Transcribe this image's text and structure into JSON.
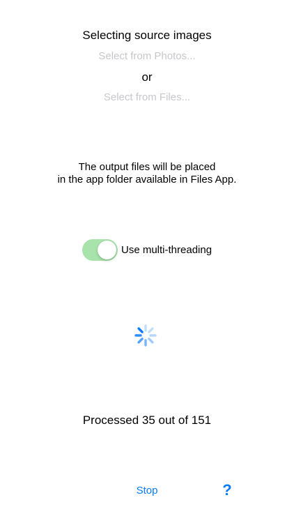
{
  "source": {
    "title": "Selecting source images",
    "photos_link": "Select from Photos...",
    "separator": "or",
    "files_link": "Select from Files..."
  },
  "output_note": {
    "line1": "The output files will be placed",
    "line2": "in the app folder available in Files App."
  },
  "multithreading": {
    "label": "Use multi-threading",
    "enabled": true,
    "on_color": "#a8e3ac"
  },
  "status": {
    "progress_text": "Processed 35 out of 151"
  },
  "footer": {
    "stop_label": "Stop",
    "help_label": "?"
  },
  "colors": {
    "accent": "#0a7aff",
    "disabled_text": "#c7c7cc",
    "spinner": "#0a7aff"
  },
  "icons": {
    "spinner": "activity-indicator-icon",
    "help": "question-mark-icon"
  }
}
